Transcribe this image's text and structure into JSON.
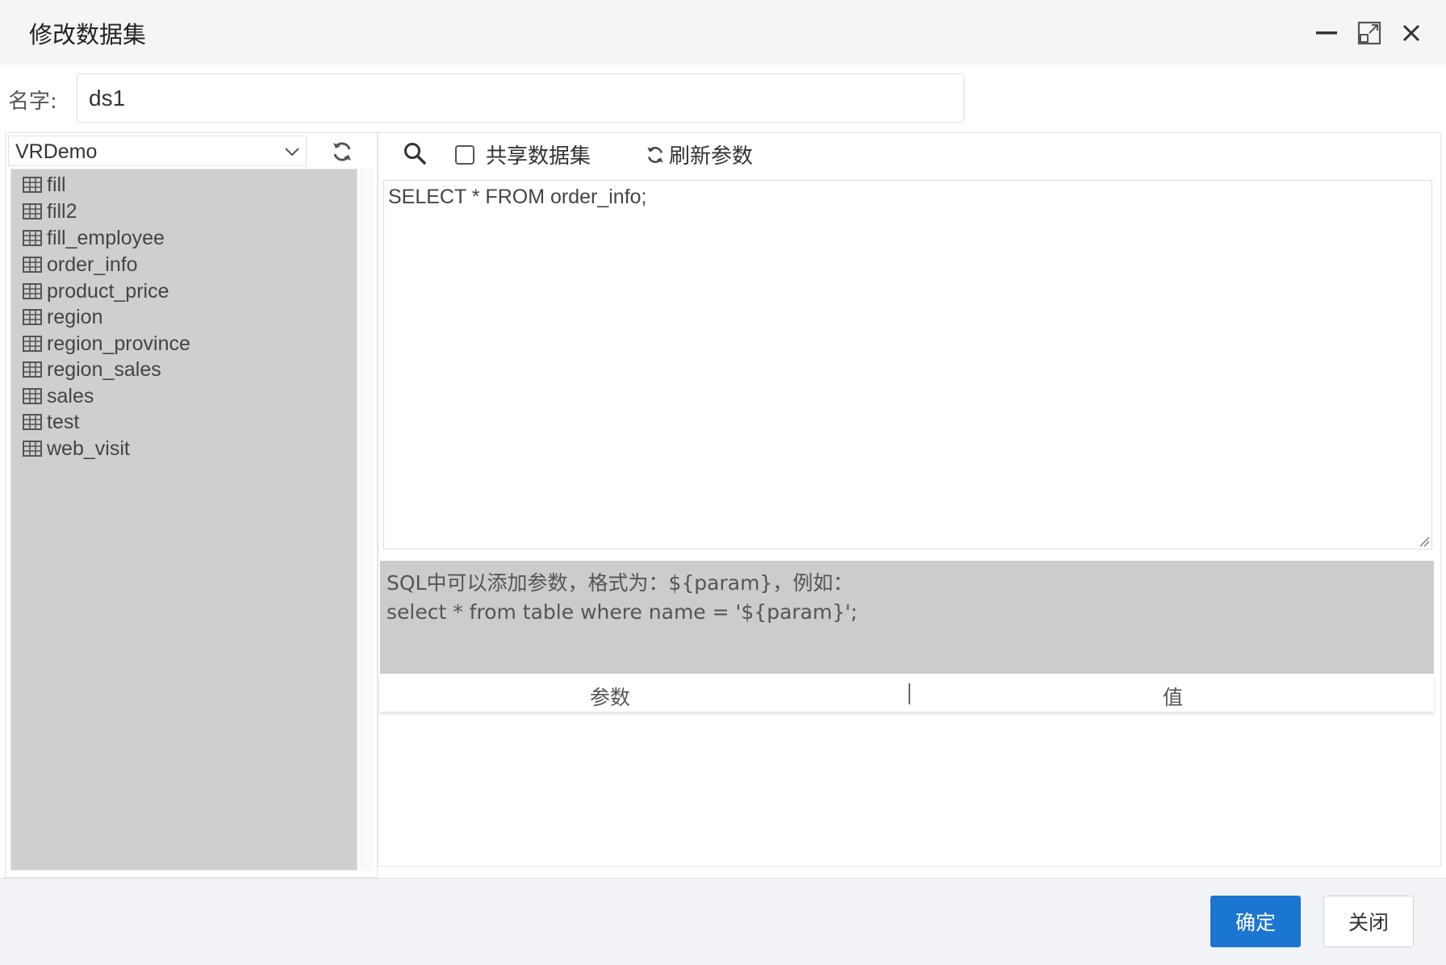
{
  "dialog": {
    "title": "修改数据集"
  },
  "name_field": {
    "label": "名字:",
    "value": "ds1"
  },
  "datasource": {
    "selected": "VRDemo",
    "tables": [
      "fill",
      "fill2",
      "fill_employee",
      "order_info",
      "product_price",
      "region",
      "region_province",
      "region_sales",
      "sales",
      "test",
      "web_visit"
    ]
  },
  "toolbar": {
    "share_label": "共享数据集",
    "refresh_params_label": "刷新参数"
  },
  "editor": {
    "sql": "SELECT * FROM order_info;"
  },
  "hint": {
    "line1": "SQL中可以添加参数，格式为：${param}，例如：",
    "line2": "select * from table where name = '${param}';"
  },
  "params_table": {
    "col_param": "参数",
    "col_value": "值"
  },
  "footer": {
    "ok_label": "确定",
    "close_label": "关闭"
  },
  "colors": {
    "primary": "#1b76d1",
    "list_bg": "#cfcfcf"
  }
}
